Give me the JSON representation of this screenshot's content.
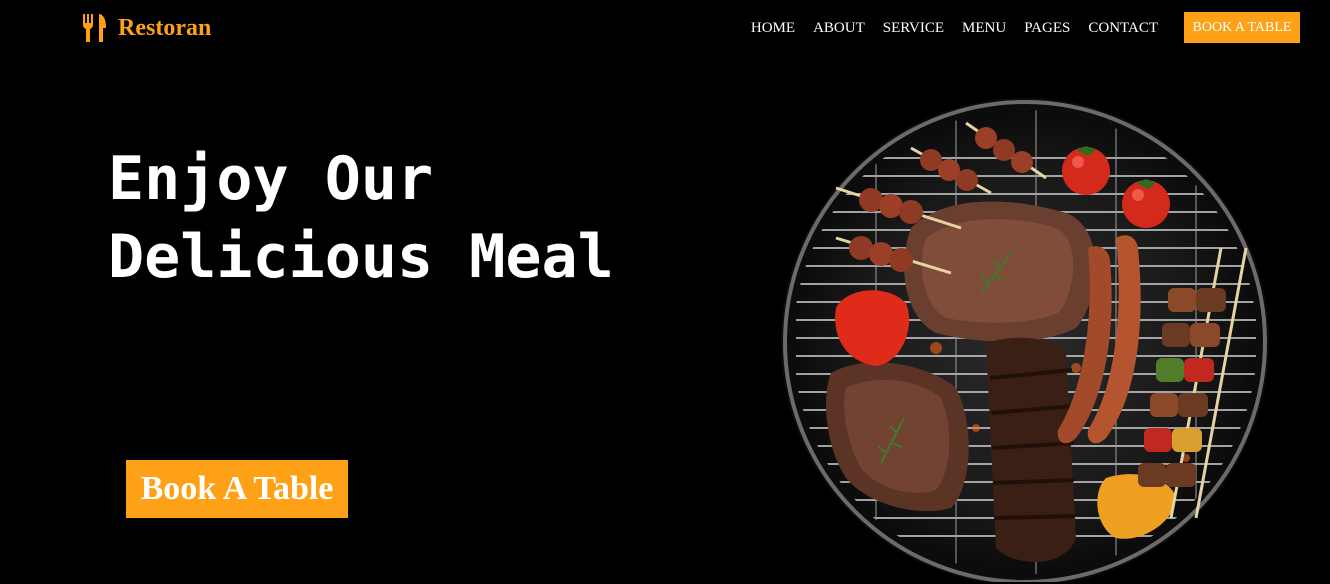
{
  "brand": {
    "name": "Restoran",
    "icon": "utensils-icon",
    "color": "#FEA116"
  },
  "nav": {
    "items": [
      "HOME",
      "ABOUT",
      "SERVICE",
      "MENU",
      "PAGES",
      "CONTACT"
    ],
    "cta_label": "BOOK A TABLE"
  },
  "hero": {
    "title_line1": "Enjoy Our",
    "title_line2": "Delicious Meal",
    "cta_label": "Book A Table",
    "image": "grilled-barbecue-image"
  },
  "colors": {
    "accent": "#FEA116",
    "background": "#000000",
    "text": "#FFFFFF"
  }
}
